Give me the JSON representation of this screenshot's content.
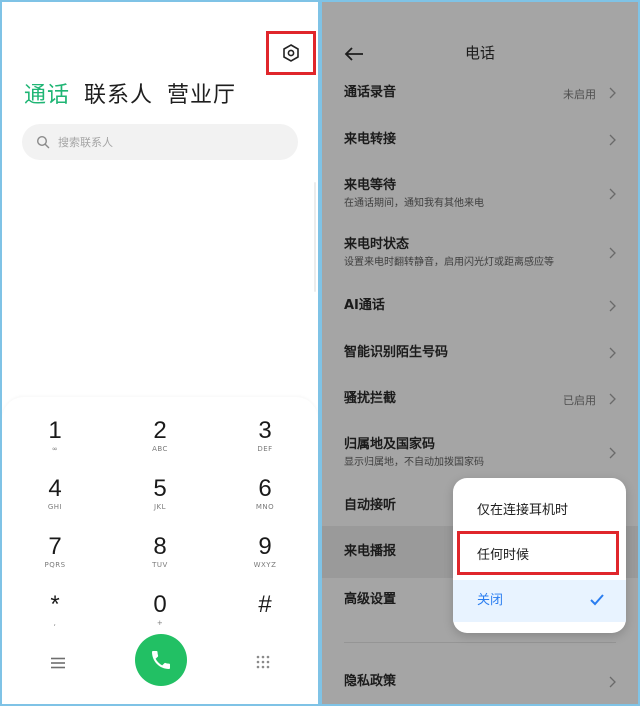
{
  "left": {
    "tabs": [
      "通话",
      "联系人",
      "营业厅"
    ],
    "search_placeholder": "搜索联系人",
    "keys": [
      {
        "digit": "1",
        "letters": "∞"
      },
      {
        "digit": "2",
        "letters": "ABC"
      },
      {
        "digit": "3",
        "letters": "DEF"
      },
      {
        "digit": "4",
        "letters": "GHI"
      },
      {
        "digit": "5",
        "letters": "JKL"
      },
      {
        "digit": "6",
        "letters": "MNO"
      },
      {
        "digit": "7",
        "letters": "PQRS"
      },
      {
        "digit": "8",
        "letters": "TUV"
      },
      {
        "digit": "9",
        "letters": "WXYZ"
      },
      {
        "digit": "*",
        "letters": ","
      },
      {
        "digit": "0",
        "letters": "+"
      },
      {
        "digit": "#",
        "letters": ""
      }
    ],
    "icons": {
      "settings": "settings-icon",
      "search": "search-icon",
      "menu": "menu-icon",
      "call": "phone-icon",
      "keypad": "keypad-icon"
    },
    "colors": {
      "accent": "#1fb574",
      "call": "#22c064",
      "highlight_box": "#e0262b"
    }
  },
  "right": {
    "title": "电话",
    "rows": [
      {
        "title": "通话录音",
        "sub": "",
        "value": "未启用"
      },
      {
        "title": "来电转接",
        "sub": "",
        "value": ""
      },
      {
        "title": "来电等待",
        "sub": "在通话期间，通知我有其他来电",
        "value": ""
      },
      {
        "title": "来电时状态",
        "sub": "设置来电时翻转静音，启用闪光灯或距离感应等",
        "value": ""
      },
      {
        "title": "AI通话",
        "sub": "",
        "value": ""
      },
      {
        "title": "智能识别陌生号码",
        "sub": "",
        "value": ""
      },
      {
        "title": "骚扰拦截",
        "sub": "",
        "value": "已启用"
      },
      {
        "title": "归属地及国家码",
        "sub": "显示归属地，不自动加拨国家码",
        "value": ""
      },
      {
        "title": "自动接听",
        "sub": "",
        "value": ""
      },
      {
        "title": "来电播报",
        "sub": "",
        "value": ""
      },
      {
        "title": "高级设置",
        "sub": "",
        "value": ""
      },
      {
        "title": "隐私政策",
        "sub": "",
        "value": ""
      }
    ],
    "popup": {
      "options": [
        "仅在连接耳机时",
        "任何时候",
        "关闭"
      ],
      "selected": "关闭"
    },
    "colors": {
      "selected_text": "#2a7df0",
      "selected_bg": "#e8f3ff"
    }
  }
}
